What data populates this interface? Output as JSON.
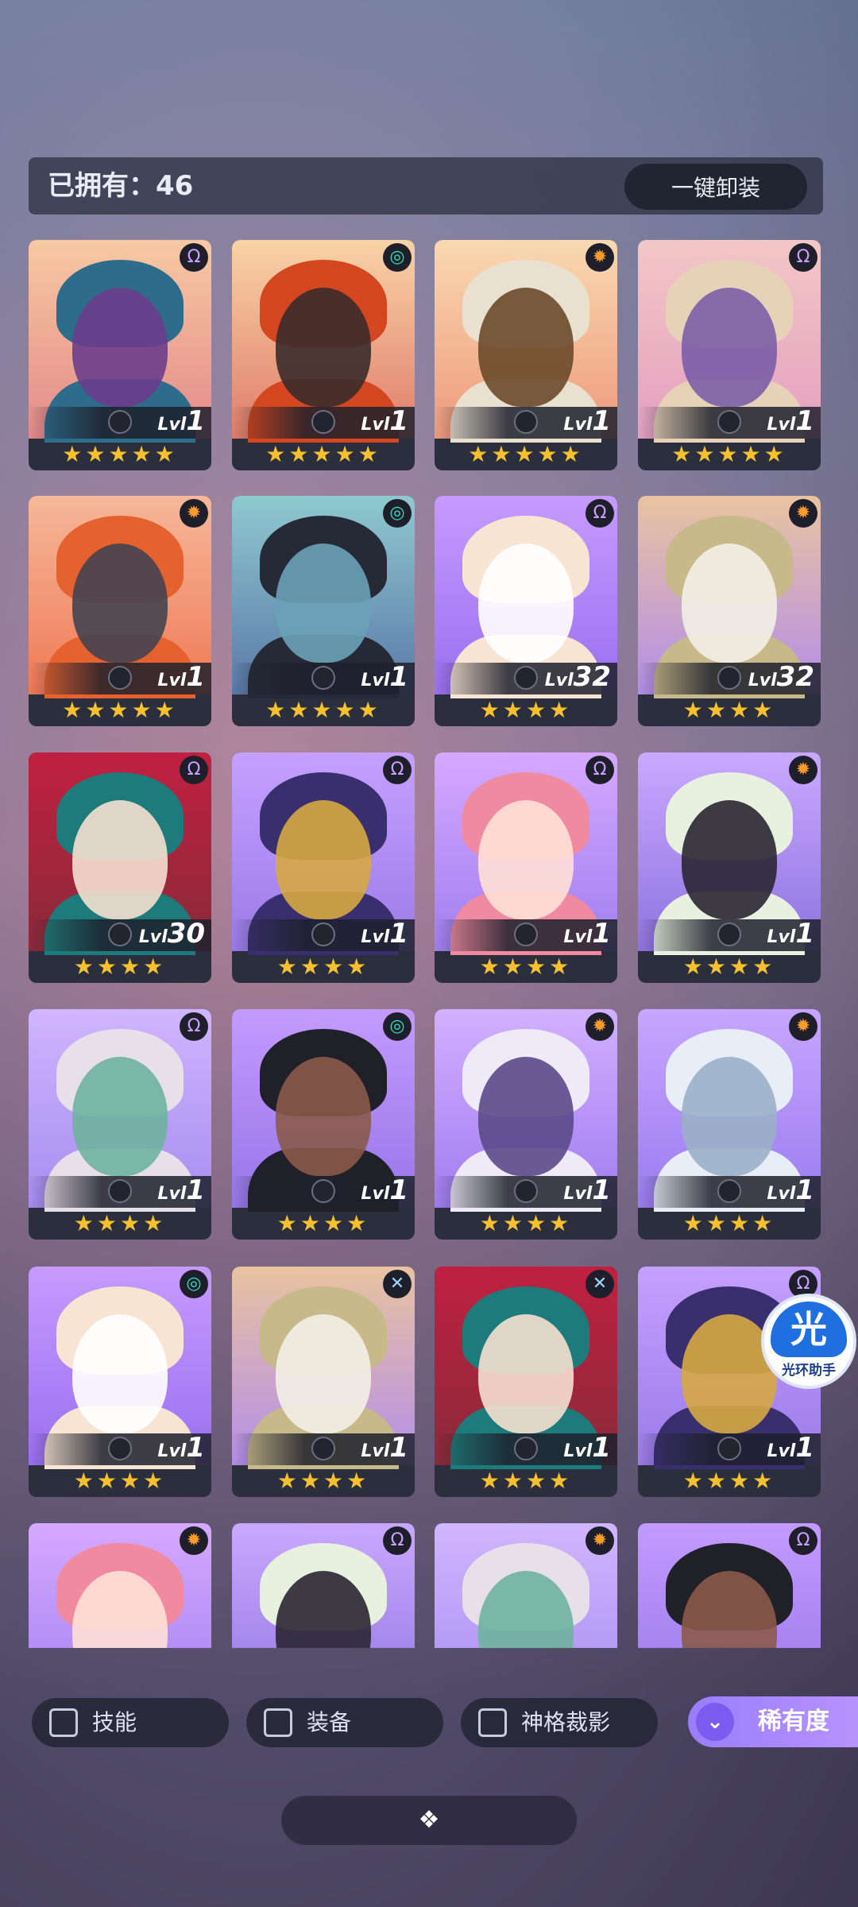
{
  "header": {
    "owned_label": "已拥有：46",
    "unequip_all_label": "一键卸装"
  },
  "colors": {
    "accent": "#a98bff",
    "star": "#f6c02f",
    "card_dark": "#2b2f3d"
  },
  "cards": [
    {
      "level": "1",
      "stars": "★★★★★",
      "faction": "omega",
      "bg": "warm"
    },
    {
      "level": "1",
      "stars": "★★★★★",
      "faction": "swirl",
      "bg": "warm"
    },
    {
      "level": "1",
      "stars": "★★★★★",
      "faction": "sun",
      "bg": "warm"
    },
    {
      "level": "1",
      "stars": "★★★★★",
      "faction": "omega",
      "bg": "warm"
    },
    {
      "level": "1",
      "stars": "★★★★★",
      "faction": "sun",
      "bg": "warm"
    },
    {
      "level": "1",
      "stars": "★★★★★",
      "faction": "swirl",
      "bg": "warm"
    },
    {
      "level": "32",
      "stars": "★★★★",
      "faction": "omega",
      "bg": "purple"
    },
    {
      "level": "32",
      "stars": "★★★★",
      "faction": "sun",
      "bg": "purple"
    },
    {
      "level": "30",
      "stars": "★★★★",
      "faction": "omega",
      "bg": "purple"
    },
    {
      "level": "1",
      "stars": "★★★★",
      "faction": "omega",
      "bg": "purple"
    },
    {
      "level": "1",
      "stars": "★★★★",
      "faction": "omega",
      "bg": "purple"
    },
    {
      "level": "1",
      "stars": "★★★★",
      "faction": "sun",
      "bg": "purple"
    },
    {
      "level": "1",
      "stars": "★★★★",
      "faction": "omega",
      "bg": "purple"
    },
    {
      "level": "1",
      "stars": "★★★★",
      "faction": "swirl",
      "bg": "purple"
    },
    {
      "level": "1",
      "stars": "★★★★",
      "faction": "sun",
      "bg": "purple"
    },
    {
      "level": "1",
      "stars": "★★★★",
      "faction": "sun",
      "bg": "purple"
    },
    {
      "level": "1",
      "stars": "★★★★",
      "faction": "swirl",
      "bg": "purple"
    },
    {
      "level": "1",
      "stars": "★★★★",
      "faction": "cross",
      "bg": "purple"
    },
    {
      "level": "1",
      "stars": "★★★★",
      "faction": "cross",
      "bg": "purple"
    },
    {
      "level": "1",
      "stars": "★★★★",
      "faction": "omega",
      "bg": "purple"
    },
    {
      "level": "",
      "stars": "",
      "faction": "sun",
      "bg": "purple"
    },
    {
      "level": "",
      "stars": "",
      "faction": "omega",
      "bg": "purple"
    },
    {
      "level": "",
      "stars": "",
      "faction": "sun",
      "bg": "purple"
    },
    {
      "level": "",
      "stars": "",
      "faction": "omega",
      "bg": "purple"
    }
  ],
  "level_prefix": "Lvl",
  "filters": [
    {
      "label": "技能"
    },
    {
      "label": "装备"
    },
    {
      "label": "神格裁影"
    }
  ],
  "sort_button": {
    "label": "稀有度"
  },
  "assistant": {
    "logo_char": "光",
    "caption": "光环助手"
  }
}
